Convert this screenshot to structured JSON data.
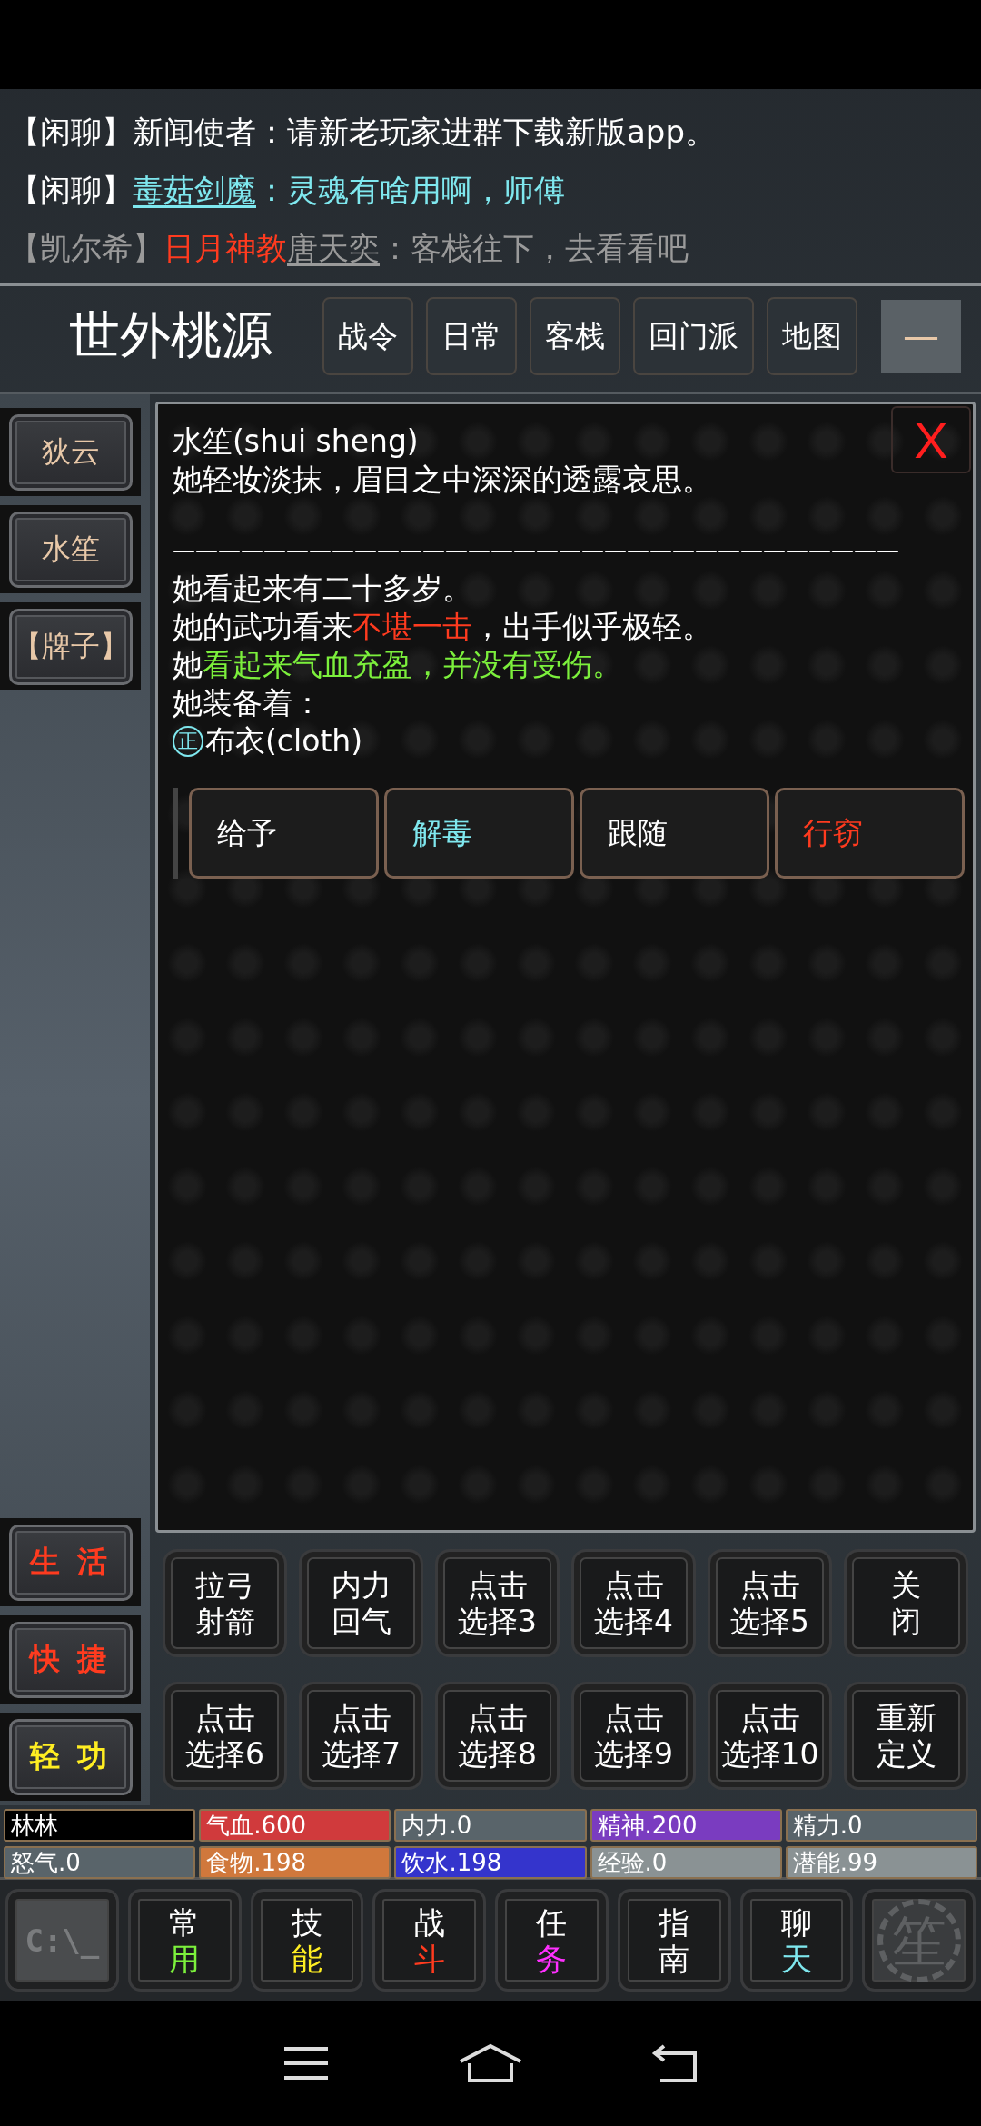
{
  "chat": [
    {
      "parts": [
        {
          "text": "【闲聊】",
          "kind": "text",
          "color": "#ffffff"
        },
        {
          "text": "新闻使者：请新老玩家进群下载新版app。",
          "kind": "text",
          "color": "#ffffff"
        }
      ]
    },
    {
      "parts": [
        {
          "text": "【闲聊】",
          "kind": "text",
          "color": "#ffffff"
        },
        {
          "text": "毒菇剑魔",
          "kind": "link",
          "color": "#7fe8ef"
        },
        {
          "text": "：灵魂有啥用啊，师傅",
          "kind": "text",
          "color": "#7fe8ef"
        }
      ]
    },
    {
      "parts": [
        {
          "text": "【凯尔希】",
          "kind": "text",
          "color": "#9a9a9a"
        },
        {
          "text": "日月神教",
          "kind": "text",
          "color": "#ff3b1f"
        },
        {
          "text": "唐天奕",
          "kind": "link",
          "color": "#9a9a9a"
        },
        {
          "text": "：客栈往下，去看看吧",
          "kind": "text",
          "color": "#9a9a9a"
        }
      ]
    }
  ],
  "header": {
    "title": "世外桃源",
    "buttons": [
      {
        "label": "战令"
      },
      {
        "label": "日常"
      },
      {
        "label": "客栈"
      },
      {
        "label": "回门派"
      },
      {
        "label": "地图"
      }
    ],
    "minimize": "—"
  },
  "sidebar": {
    "npcs": [
      {
        "label": "狄云"
      },
      {
        "label": "水笙"
      },
      {
        "label": "【牌子】"
      }
    ],
    "menus": [
      {
        "label": "生 活",
        "color": "#ff3b1f"
      },
      {
        "label": "快 捷",
        "color": "#ff3b1f"
      },
      {
        "label": "轻 功",
        "color": "#ffee22"
      }
    ]
  },
  "panel": {
    "close": "X",
    "lines": [
      {
        "parts": [
          {
            "text": "水笙(shui sheng)",
            "color": "#ffffff"
          }
        ]
      },
      {
        "parts": [
          {
            "text": "她轻妆淡抹，眉目之中深深的透露哀思。",
            "color": "#ffffff"
          }
        ]
      },
      {
        "parts": [
          {
            "text": "————————————————————————————————",
            "color": "#ffffff"
          }
        ],
        "kind": "divider"
      },
      {
        "parts": [
          {
            "text": "她看起来有二十多岁。",
            "color": "#ffffff"
          }
        ]
      },
      {
        "parts": [
          {
            "text": "她的武功看来",
            "color": "#ffffff"
          },
          {
            "text": "不堪一击",
            "color": "#ff3b1f"
          },
          {
            "text": "，出手似乎极轻。",
            "color": "#ffffff"
          }
        ]
      },
      {
        "parts": [
          {
            "text": "她",
            "color": "#ffffff"
          },
          {
            "text": "看起来气血充盈，并没有受伤。",
            "color": "#7cf03c"
          }
        ]
      },
      {
        "parts": [
          {
            "text": "她装备着：",
            "color": "#ffffff"
          }
        ]
      }
    ],
    "equipment": [
      {
        "mark": "正",
        "text": "布衣(cloth)"
      }
    ],
    "actions": [
      {
        "label": "给予",
        "color": "#ffffff"
      },
      {
        "label": "解毒",
        "color": "#7fe8ef"
      },
      {
        "label": "跟随",
        "color": "#ffffff"
      },
      {
        "label": "行窃",
        "color": "#ff3b1f"
      }
    ]
  },
  "skills": [
    {
      "lines": [
        "拉弓",
        "射箭"
      ]
    },
    {
      "lines": [
        "内力",
        "回气"
      ]
    },
    {
      "lines": [
        "点击",
        "选择3"
      ]
    },
    {
      "lines": [
        "点击",
        "选择4"
      ]
    },
    {
      "lines": [
        "点击",
        "选择5"
      ]
    },
    {
      "lines": [
        "关",
        "闭"
      ]
    },
    {
      "lines": [
        "点击",
        "选择6"
      ]
    },
    {
      "lines": [
        "点击",
        "选择7"
      ]
    },
    {
      "lines": [
        "点击",
        "选择8"
      ]
    },
    {
      "lines": [
        "点击",
        "选择9"
      ]
    },
    {
      "lines": [
        "点击",
        "选择10"
      ]
    },
    {
      "lines": [
        "重新",
        "定义"
      ]
    }
  ],
  "stats": [
    {
      "text": "林林",
      "color": "#000000"
    },
    {
      "text": "气血.600",
      "color": "#d03a3c"
    },
    {
      "text": "内力.0",
      "color": "#59646a"
    },
    {
      "text": "精神.200",
      "color": "#7a3cc0"
    },
    {
      "text": "精力.0",
      "color": "#59646a"
    },
    {
      "text": "怒气.0",
      "color": "#59646a"
    },
    {
      "text": "食物.198",
      "color": "#d0783c"
    },
    {
      "text": "饮水.198",
      "color": "#3434cc"
    },
    {
      "text": "经验.0",
      "color": "#8a9294"
    },
    {
      "text": "潜能.99",
      "color": "#8a9294"
    }
  ],
  "nav": [
    {
      "kind": "console",
      "label": "C:\\_"
    },
    {
      "kind": "tab",
      "top": "常",
      "bottom": "用",
      "color": "#7cf03c"
    },
    {
      "kind": "tab",
      "top": "技",
      "bottom": "能",
      "color": "#ffee22"
    },
    {
      "kind": "tab",
      "top": "战",
      "bottom": "斗",
      "color": "#ff3b1f"
    },
    {
      "kind": "tab",
      "top": "任",
      "bottom": "务",
      "color": "#ff30ff"
    },
    {
      "kind": "tab",
      "top": "指",
      "bottom": "南",
      "color": "#ffffff"
    },
    {
      "kind": "tab",
      "top": "聊",
      "bottom": "天",
      "color": "#7fe8ef"
    },
    {
      "kind": "gear",
      "label": "笙"
    }
  ]
}
